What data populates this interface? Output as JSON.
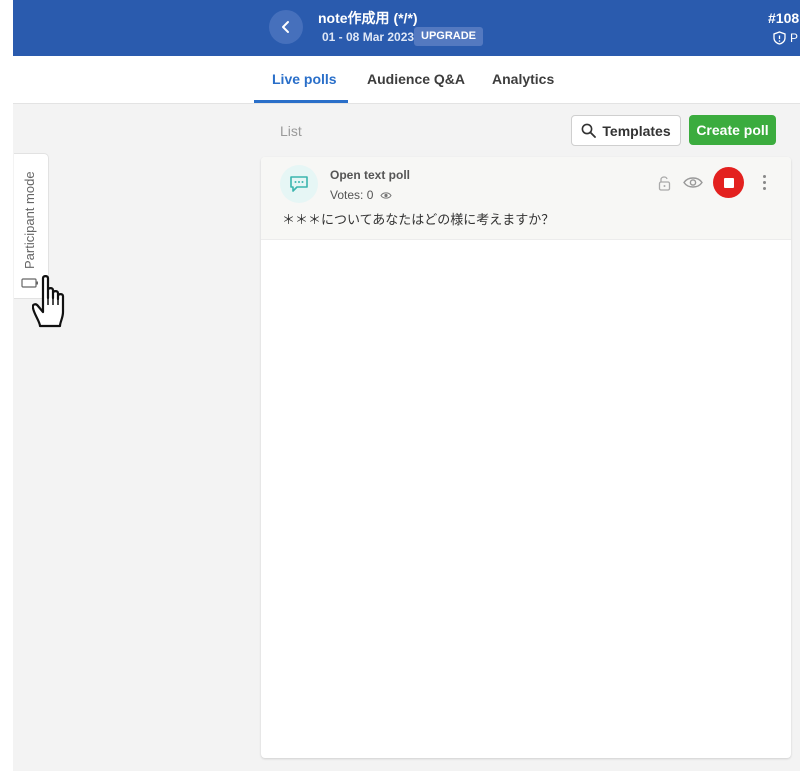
{
  "header": {
    "event_title": "note作成用 (*/*)",
    "event_dates": "01 - 08 Mar 2023",
    "upgrade_label": "UPGRADE",
    "event_code": "#108",
    "privacy_label": "P"
  },
  "tabs": [
    {
      "label": "Live polls",
      "active": true
    },
    {
      "label": "Audience Q&A",
      "active": false
    },
    {
      "label": "Analytics",
      "active": false
    }
  ],
  "toolbar": {
    "list_label": "List",
    "templates_label": "Templates",
    "create_poll_label": "Create poll"
  },
  "side_panel": {
    "participant_mode_label": "Participant mode"
  },
  "poll": {
    "type_label": "Open text poll",
    "votes_label": "Votes: 0",
    "question": "＊＊＊についてあなたはどの様に考えますか？"
  },
  "colors": {
    "header_bg": "#2a5bae",
    "accent_blue": "#2a6fc9",
    "create_green": "#3bac3e",
    "stop_red": "#e3211f",
    "poll_icon_teal": "#3bb5ae"
  },
  "icons": {
    "back": "chevron-left-icon",
    "privacy": "shield-icon",
    "search": "search-icon",
    "device": "device-icon",
    "poll_type": "chat-bubble-icon",
    "votes": "eye-icon",
    "lock": "unlock-icon",
    "visibility": "eye-icon",
    "stop": "stop-icon",
    "more": "kebab-menu-icon",
    "cursor": "hand-pointer-icon"
  }
}
